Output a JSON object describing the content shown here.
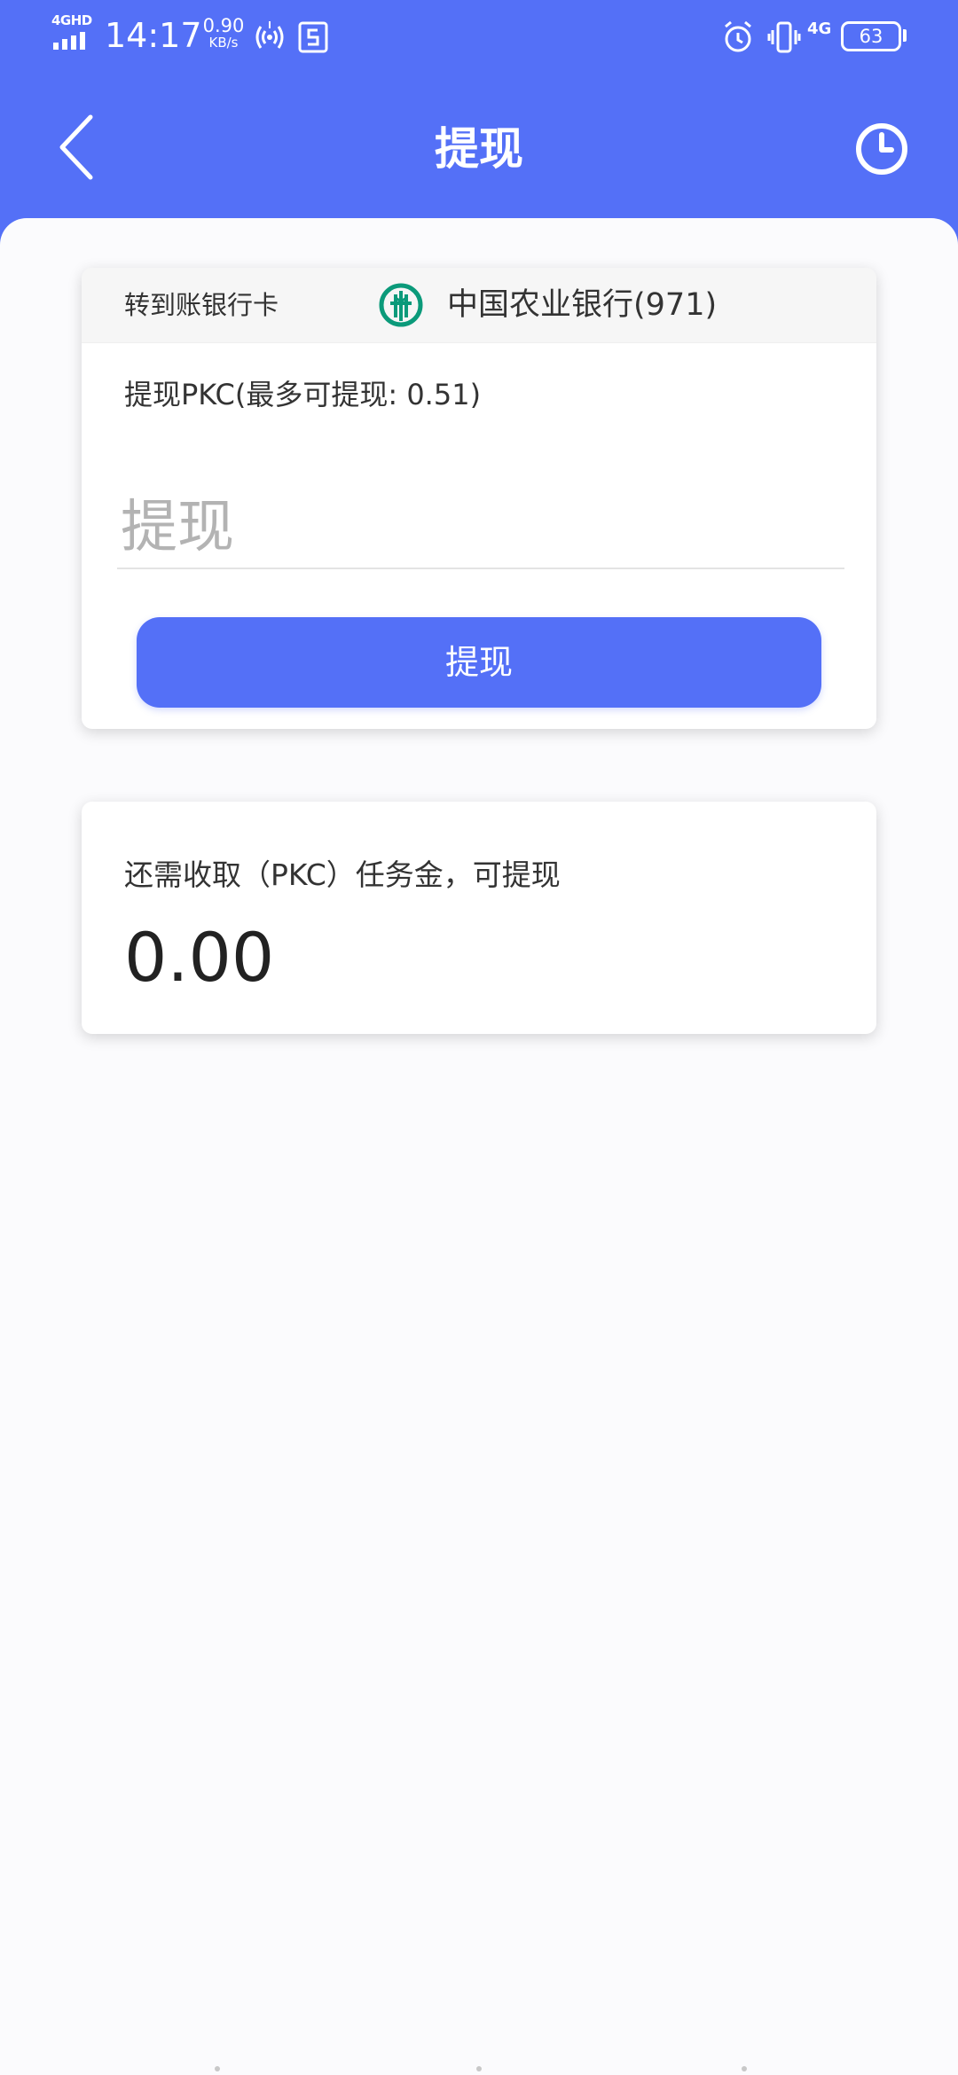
{
  "status_bar": {
    "network_type": "4GHD",
    "time": "14:17",
    "speed_value": "0.90",
    "speed_unit": "KB/s",
    "mobile_data": "4G",
    "battery_percent": "63",
    "icons": [
      "signal-icon",
      "hotspot-icon",
      "screenshot-icon",
      "alarm-icon",
      "vibrate-icon",
      "battery-icon"
    ]
  },
  "header": {
    "title": "提现",
    "back_icon": "chevron-left-icon",
    "history_icon": "clock-icon"
  },
  "withdraw_card": {
    "bank_row_label": "转到账银行卡",
    "bank_name": "中国农业银行(971)",
    "bank_logo_icon": "abc-bank-logo-icon",
    "amount_label": "提现PKC(最多可提现: 0.51)",
    "amount_placeholder": "提现",
    "submit_label": "提现"
  },
  "task_card": {
    "label": "还需收取（PKC）任务金，可提现",
    "value": "0.00"
  },
  "colors": {
    "primary": "#5470f7",
    "background": "#fbfbfd",
    "text": "#333333",
    "bank_logo": "#0b9a7a"
  }
}
